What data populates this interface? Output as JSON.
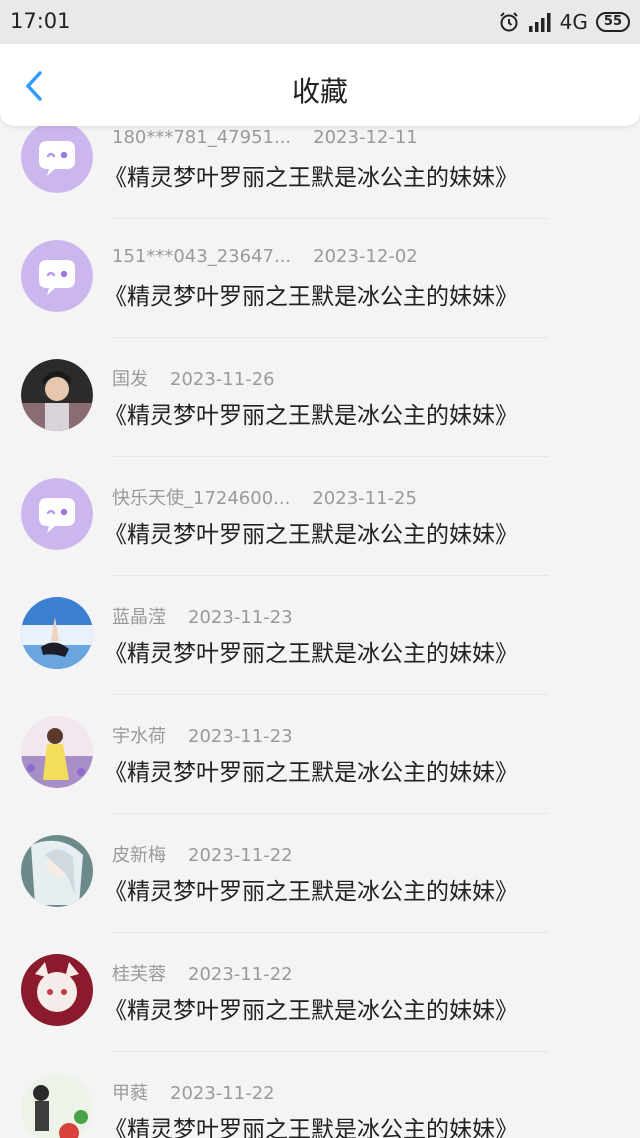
{
  "status_bar": {
    "time": "17:01",
    "network": "4G",
    "battery": "55"
  },
  "header": {
    "title": "收藏"
  },
  "items": [
    {
      "name": "180***781_47951...",
      "date": "2023-12-11",
      "title": "《精灵梦叶罗丽之王默是冰公主的妹妹》",
      "avatar": "default-chat-icon"
    },
    {
      "name": "151***043_23647...",
      "date": "2023-12-02",
      "title": "《精灵梦叶罗丽之王默是冰公主的妹妹》",
      "avatar": "default-chat-icon"
    },
    {
      "name": "国发",
      "date": "2023-11-26",
      "title": "《精灵梦叶罗丽之王默是冰公主的妹妹》",
      "avatar": "photo"
    },
    {
      "name": "快乐天使_1724600...",
      "date": "2023-11-25",
      "title": "《精灵梦叶罗丽之王默是冰公主的妹妹》",
      "avatar": "default-chat-icon"
    },
    {
      "name": "蓝晶滢",
      "date": "2023-11-23",
      "title": "《精灵梦叶罗丽之王默是冰公主的妹妹》",
      "avatar": "photo"
    },
    {
      "name": "宇水荷",
      "date": "2023-11-23",
      "title": "《精灵梦叶罗丽之王默是冰公主的妹妹》",
      "avatar": "photo"
    },
    {
      "name": "皮新梅",
      "date": "2023-11-22",
      "title": "《精灵梦叶罗丽之王默是冰公主的妹妹》",
      "avatar": "photo"
    },
    {
      "name": "桂芙蓉",
      "date": "2023-11-22",
      "title": "《精灵梦叶罗丽之王默是冰公主的妹妹》",
      "avatar": "photo"
    },
    {
      "name": "甲蕤",
      "date": "2023-11-22",
      "title": "《精灵梦叶罗丽之王默是冰公主的妹妹》",
      "avatar": "photo"
    }
  ]
}
